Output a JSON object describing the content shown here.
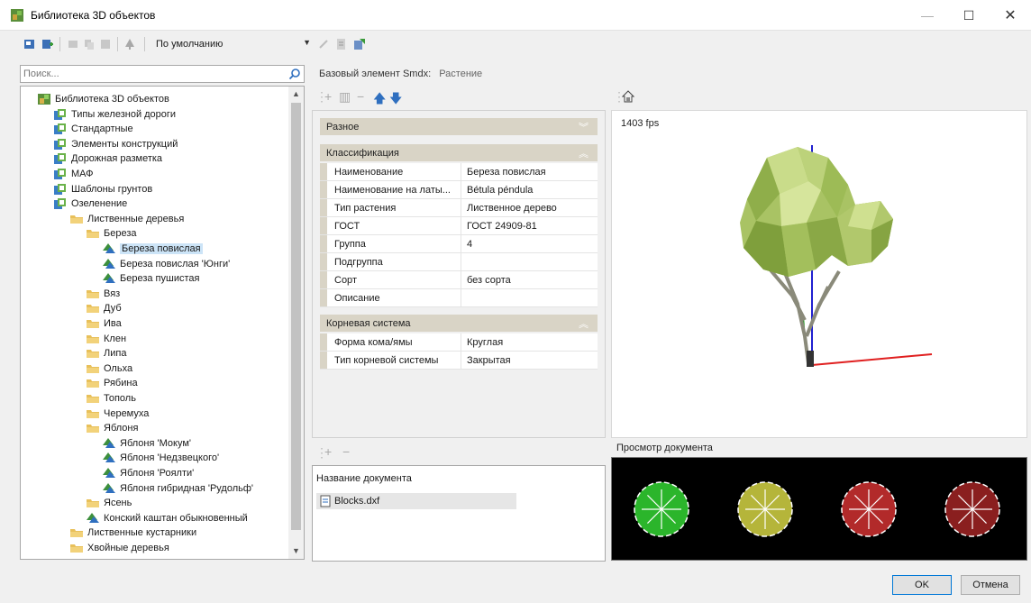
{
  "window": {
    "title": "Библиотека 3D объектов",
    "minimize_icon": "minimize-icon",
    "maximize_icon": "maximize-icon",
    "close_icon": "close-icon",
    "maximize_glyph": "☐",
    "close_glyph": "✕",
    "minimize_glyph": "—"
  },
  "toolbar": {
    "style_value": "По умолчанию"
  },
  "search": {
    "placeholder": "Поиск..."
  },
  "tree": {
    "items": [
      {
        "label": "Библиотека 3D объектов",
        "icon": "library-icon",
        "level": 0
      },
      {
        "label": "Типы железной дороги",
        "icon": "category-icon",
        "level": 1
      },
      {
        "label": "Стандартные",
        "icon": "category-icon",
        "level": 1
      },
      {
        "label": "Элементы конструкций",
        "icon": "category-icon",
        "level": 1
      },
      {
        "label": "Дорожная разметка",
        "icon": "category-icon",
        "level": 1
      },
      {
        "label": "МАФ",
        "icon": "category-icon",
        "level": 1
      },
      {
        "label": "Шаблоны грунтов",
        "icon": "category-icon",
        "level": 1
      },
      {
        "label": "Озеленение",
        "icon": "category-icon",
        "level": 1
      },
      {
        "label": "Лиственные деревья",
        "icon": "folder-icon",
        "level": 2
      },
      {
        "label": "Береза",
        "icon": "folder-icon",
        "level": 3
      },
      {
        "label": "Береза повислая",
        "icon": "tree-object-icon",
        "level": 4,
        "selected": true
      },
      {
        "label": "Береза повислая 'Юнги'",
        "icon": "tree-object-icon",
        "level": 4
      },
      {
        "label": "Береза пушистая",
        "icon": "tree-object-icon",
        "level": 4
      },
      {
        "label": "Вяз",
        "icon": "folder-icon",
        "level": 3
      },
      {
        "label": "Дуб",
        "icon": "folder-icon",
        "level": 3
      },
      {
        "label": "Ива",
        "icon": "folder-icon",
        "level": 3
      },
      {
        "label": "Клен",
        "icon": "folder-icon",
        "level": 3
      },
      {
        "label": "Липа",
        "icon": "folder-icon",
        "level": 3
      },
      {
        "label": "Ольха",
        "icon": "folder-icon",
        "level": 3
      },
      {
        "label": "Рябина",
        "icon": "folder-icon",
        "level": 3
      },
      {
        "label": "Тополь",
        "icon": "folder-icon",
        "level": 3
      },
      {
        "label": "Черемуха",
        "icon": "folder-icon",
        "level": 3
      },
      {
        "label": "Яблоня",
        "icon": "folder-icon",
        "level": 3
      },
      {
        "label": "Яблоня 'Мокум'",
        "icon": "tree-object-icon",
        "level": 4
      },
      {
        "label": "Яблоня 'Недзвецкого'",
        "icon": "tree-object-icon",
        "level": 4
      },
      {
        "label": "Яблоня 'Роялти'",
        "icon": "tree-object-icon",
        "level": 4
      },
      {
        "label": "Яблоня гибридная 'Рудольф'",
        "icon": "tree-object-icon",
        "level": 4
      },
      {
        "label": "Ясень",
        "icon": "folder-icon",
        "level": 3
      },
      {
        "label": "Конский каштан обыкновенный",
        "icon": "tree-object-icon",
        "level": 3
      },
      {
        "label": "Лиственные кустарники",
        "icon": "folder-icon",
        "level": 2
      },
      {
        "label": "Хвойные деревья",
        "icon": "folder-icon",
        "level": 2
      }
    ]
  },
  "breadcrumb": {
    "label": "Базовый элемент Smdx:",
    "value": "Растение"
  },
  "properties": {
    "groups": [
      {
        "title": "Разное",
        "collapsed": true,
        "rows": []
      },
      {
        "title": "Классификация",
        "collapsed": false,
        "rows": [
          {
            "name": "Наименование",
            "value": "Береза повислая"
          },
          {
            "name": "Наименование на латы...",
            "value": "Bétula péndula"
          },
          {
            "name": "Тип растения",
            "value": "Лиственное дерево"
          },
          {
            "name": "ГОСТ",
            "value": "ГОСТ 24909-81"
          },
          {
            "name": "Группа",
            "value": "4"
          },
          {
            "name": "Подгруппа",
            "value": ""
          },
          {
            "name": "Сорт",
            "value": "без сорта"
          },
          {
            "name": "Описание",
            "value": ""
          }
        ]
      },
      {
        "title": "Корневая система",
        "collapsed": false,
        "rows": [
          {
            "name": "Форма кома/ямы",
            "value": "Круглая"
          },
          {
            "name": "Тип корневой системы",
            "value": "Закрытая"
          }
        ]
      }
    ]
  },
  "documents": {
    "header": "Название документа",
    "files": [
      "Blocks.dxf"
    ]
  },
  "viewport": {
    "fps": "1403 fps"
  },
  "preview": {
    "label": "Просмотр документа",
    "colors": [
      "#2bb52b",
      "#b5b53a",
      "#b22a2a",
      "#8a1f1f"
    ]
  },
  "buttons": {
    "ok": "OK",
    "cancel": "Отмена"
  }
}
